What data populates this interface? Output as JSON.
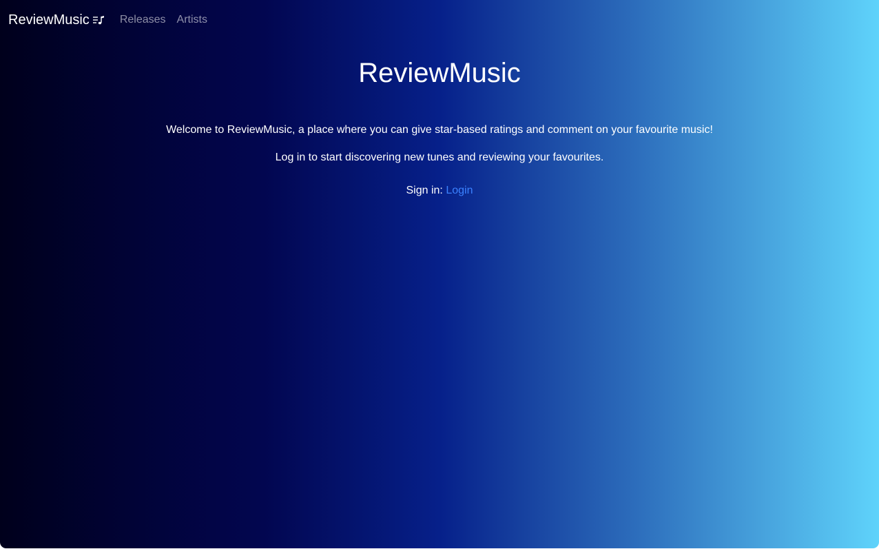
{
  "navbar": {
    "brand": "ReviewMusic",
    "brand_icon": "music-note-list-icon",
    "links": [
      {
        "label": "Releases"
      },
      {
        "label": "Artists"
      }
    ]
  },
  "main": {
    "title": "ReviewMusic",
    "welcome": "Welcome to ReviewMusic, a place where you can give star-based ratings and comment on your favourite music!",
    "prompt": "Log in to start discovering new tunes and reviewing your favourites.",
    "signin_label": "Sign in:",
    "login_link": "Login"
  },
  "colors": {
    "gradient_start": "#00001c",
    "gradient_end": "#5fd3fb",
    "link": "#3b82ff"
  }
}
